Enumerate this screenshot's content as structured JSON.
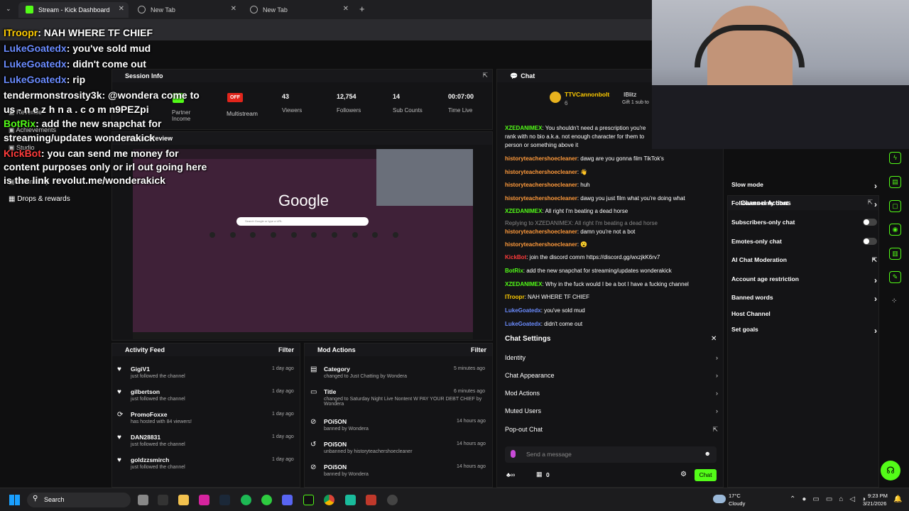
{
  "browser": {
    "tabs": [
      {
        "title": "Stream - Kick Dashboard",
        "active": true
      },
      {
        "title": "New Tab",
        "active": false
      },
      {
        "title": "New Tab",
        "active": false
      }
    ]
  },
  "overlay_chat": [
    {
      "user": "ITroopr",
      "text": ": NAH WHERE TF CHIEF",
      "color": "#ffcc00"
    },
    {
      "user": "LukeGoatedx",
      "text": ": you've sold mud",
      "color": "#6b8cff"
    },
    {
      "user": "LukeGoatedx",
      "text": ": didn't come out",
      "color": "#6b8cff"
    },
    {
      "user": "LukeGoatedx",
      "text": ": rip",
      "color": "#6b8cff"
    },
    {
      "user": "tendermonstrosity3k",
      "text": ": @wondera come to",
      "color": "#ffffff"
    },
    {
      "user": "",
      "text": "us - n e z h n a . c o m n9PEZpi",
      "color": "#ffffff"
    },
    {
      "user": "BotRix",
      "text": ": add the new snapchat for",
      "color": "#53fc18"
    },
    {
      "user": "",
      "text": "streaming/updates wonderakick",
      "color": "#ffffff"
    },
    {
      "user": "KickBot",
      "text": ": you can send me money for",
      "color": "#ff3b3b"
    },
    {
      "user": "",
      "text": "content purposes only or irl out going here",
      "color": "#ffffff"
    },
    {
      "user": "",
      "text": "is the link revolut.me/wonderakick",
      "color": "#ffffff"
    }
  ],
  "sidebar": {
    "items": [
      "Revenue",
      "Achievements",
      "Studio",
      "Community",
      "Drops & rewards"
    ]
  },
  "session_info": {
    "title": "Session Info",
    "multistream_badge": "OFF",
    "multistream_label": "Multistream",
    "partner_label": "Partner Income",
    "stats": [
      {
        "value": "43",
        "label": "Viewers"
      },
      {
        "value": "12,754",
        "label": "Followers"
      },
      {
        "value": "14",
        "label": "Sub Counts"
      },
      {
        "value": "00:07:00",
        "label": "Time Live"
      }
    ]
  },
  "stream_preview": {
    "title": "Stream Preview",
    "google_logo": "Google",
    "search_placeholder": "Search Google or type a URL"
  },
  "chat": {
    "title": "Chat",
    "pinned_user": "TTVCannonbolt",
    "pinned_count": "6",
    "gifter": "IBlitz",
    "gift_text": "Gift 1 sub to",
    "messages": [
      {
        "user": "XZEDANIMEX",
        "text": ": You shouldn't need a prescription you're",
        "color": "#53fc18"
      },
      {
        "user": "",
        "text": "rank with no bio a.k.a. not enough character for them to",
        "color": "#fff"
      },
      {
        "user": "",
        "text": "person or something above it",
        "color": "#fff"
      },
      {
        "user": "historyteachershoecleaner",
        "text": ": dawg are you gonna film TikTok's",
        "color": "#ff9a3b"
      },
      {
        "user": "historyteachershoecleaner",
        "text": ": 👋",
        "color": "#ff9a3b"
      },
      {
        "user": "historyteachershoecleaner",
        "text": ": huh",
        "color": "#ff9a3b"
      },
      {
        "user": "historyteachershoecleaner",
        "text": ": dawg you just film what you're doing what",
        "color": "#ff9a3b"
      },
      {
        "user": "XZEDANIMEX",
        "text": ": All right I'm beating a dead horse",
        "color": "#53fc18"
      },
      {
        "user": "",
        "text": "Replying to XZEDANIMEX: All right I'm beating a dead horse",
        "color": "#888"
      },
      {
        "user": "historyteachershoecleaner",
        "text": ": damn you're not a bot",
        "color": "#ff9a3b"
      },
      {
        "user": "historyteachershoecleaner",
        "text": ": 😮",
        "color": "#ff9a3b"
      },
      {
        "user": "KickBot",
        "text": ": join the discord comm https://discord.gg/wxzjkK6rv7",
        "color": "#ff3b3b"
      },
      {
        "user": "BotRix",
        "text": ": add the new snapchat for streaming/updates wonderakick",
        "color": "#53fc18"
      },
      {
        "user": "XZEDANIMEX",
        "text": ": Why in the fuck would I be a bot I have a fucking channel",
        "color": "#53fc18"
      },
      {
        "user": "ITroopr",
        "text": ": NAH WHERE TF CHIEF",
        "color": "#ffcc00"
      },
      {
        "user": "LukeGoatedx",
        "text": ": you've sold mud",
        "color": "#6b8cff"
      },
      {
        "user": "LukeGoatedx",
        "text": ": didn't come out",
        "color": "#6b8cff"
      }
    ],
    "settings_title": "Chat Settings",
    "settings": [
      "Identity",
      "Chat Appearance",
      "Mod Actions",
      "Muted Users",
      "Pop-out Chat"
    ],
    "send_placeholder": "Send a message",
    "points": "0",
    "chat_button": "Chat"
  },
  "channel_actions": {
    "title": "Channel Actions",
    "items": [
      {
        "label": "Slow mode",
        "kind": "chevron"
      },
      {
        "label": "Followers-only chat",
        "kind": "chevron"
      },
      {
        "label": "Subscribers-only chat",
        "kind": "toggle"
      },
      {
        "label": "Emotes-only chat",
        "kind": "toggle"
      },
      {
        "label": "AI Chat Moderation",
        "kind": "external"
      },
      {
        "label": "Account age restriction",
        "kind": "chevron"
      },
      {
        "label": "Banned words",
        "kind": "chevron"
      },
      {
        "label": "Host Channel",
        "kind": "none"
      },
      {
        "label": "Set goals",
        "kind": "chevron"
      }
    ]
  },
  "activity_feed": {
    "title": "Activity Feed",
    "filter": "Filter",
    "items": [
      {
        "name": "GigiV1",
        "sub": "just followed the channel",
        "time": "1 day ago"
      },
      {
        "name": "gilbertson",
        "sub": "just followed the channel",
        "time": "1 day ago"
      },
      {
        "name": "PromoFoxxe",
        "sub": "has hosted with 84 viewers!",
        "time": "1 day ago"
      },
      {
        "name": "DAN28831",
        "sub": "just followed the channel",
        "time": "1 day ago"
      },
      {
        "name": "goldzzsmirch",
        "sub": "just followed the channel",
        "time": "1 day ago"
      }
    ]
  },
  "mod_actions": {
    "title": "Mod Actions",
    "filter": "Filter",
    "items": [
      {
        "name": "Category",
        "sub": "changed to Just Chatting by Wondera",
        "time": "5 minutes ago"
      },
      {
        "name": "Title",
        "sub": "changed to Saturday Night Live Nontent W PAY YOUR DEBT CHIEF by Wondera",
        "time": "6 minutes ago"
      },
      {
        "name": "POi5ON",
        "sub": "banned by Wondera",
        "time": "14 hours ago"
      },
      {
        "name": "POi5ON",
        "sub": "unbanned by historyteachershoecleaner",
        "time": "14 hours ago"
      },
      {
        "name": "POi5ON",
        "sub": "banned by Wondera",
        "time": "14 hours ago"
      }
    ]
  },
  "taskbar": {
    "search": "Search",
    "weather_temp": "17°C",
    "weather_desc": "Cloudy",
    "time": "9:23 PM",
    "date": "3/21/2026"
  },
  "colors": {
    "accent": "#53fc18",
    "bg": "#0f0f10",
    "panel": "#141416"
  }
}
